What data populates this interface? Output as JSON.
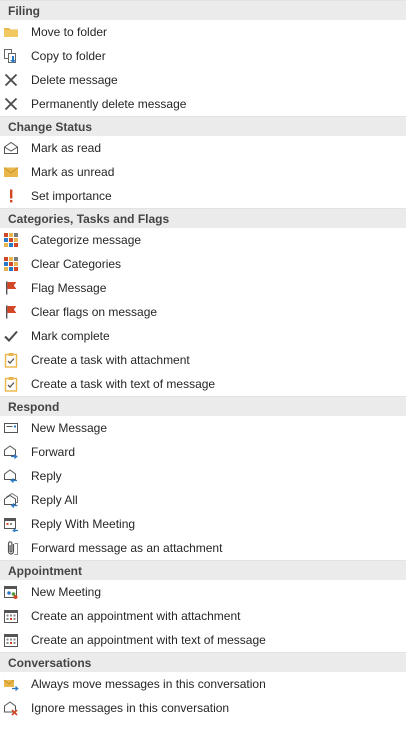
{
  "colors": {
    "header_bg": "#ebebeb",
    "folder_yellow": "#e8b64a",
    "flag_red": "#d24726",
    "icon_gray": "#555555",
    "icon_blue": "#2b78c5"
  },
  "sections": [
    {
      "title": "Filing",
      "items": [
        {
          "label": "Move to folder",
          "icon": "folder-icon"
        },
        {
          "label": "Copy to folder",
          "icon": "copy-to-folder-icon"
        },
        {
          "label": "Delete message",
          "icon": "delete-x-icon"
        },
        {
          "label": "Permanently delete message",
          "icon": "delete-x-icon"
        }
      ]
    },
    {
      "title": "Change Status",
      "items": [
        {
          "label": "Mark as read",
          "icon": "open-envelope-icon"
        },
        {
          "label": "Mark as unread",
          "icon": "closed-envelope-icon"
        },
        {
          "label": "Set importance",
          "icon": "exclamation-icon"
        }
      ]
    },
    {
      "title": "Categories, Tasks and Flags",
      "items": [
        {
          "label": "Categorize message",
          "icon": "categories-grid-icon"
        },
        {
          "label": "Clear Categories",
          "icon": "categories-grid-icon"
        },
        {
          "label": "Flag Message",
          "icon": "flag-icon"
        },
        {
          "label": "Clear flags on message",
          "icon": "flag-icon"
        },
        {
          "label": "Mark complete",
          "icon": "checkmark-icon"
        },
        {
          "label": "Create a task with attachment",
          "icon": "task-clipboard-icon"
        },
        {
          "label": "Create a task with text of message",
          "icon": "task-clipboard-icon"
        }
      ]
    },
    {
      "title": "Respond",
      "items": [
        {
          "label": "New Message",
          "icon": "new-message-icon"
        },
        {
          "label": "Forward",
          "icon": "forward-icon"
        },
        {
          "label": "Reply",
          "icon": "reply-icon"
        },
        {
          "label": "Reply All",
          "icon": "reply-all-icon"
        },
        {
          "label": "Reply With Meeting",
          "icon": "reply-meeting-icon"
        },
        {
          "label": "Forward message as an attachment",
          "icon": "paperclip-icon"
        }
      ]
    },
    {
      "title": "Appointment",
      "items": [
        {
          "label": "New Meeting",
          "icon": "new-meeting-icon"
        },
        {
          "label": "Create an appointment with attachment",
          "icon": "calendar-icon"
        },
        {
          "label": "Create an appointment with text of message",
          "icon": "calendar-icon"
        }
      ]
    },
    {
      "title": "Conversations",
      "items": [
        {
          "label": "Always move messages in this conversation",
          "icon": "move-conversation-icon"
        },
        {
          "label": "Ignore messages in this conversation",
          "icon": "ignore-conversation-icon"
        }
      ]
    }
  ]
}
